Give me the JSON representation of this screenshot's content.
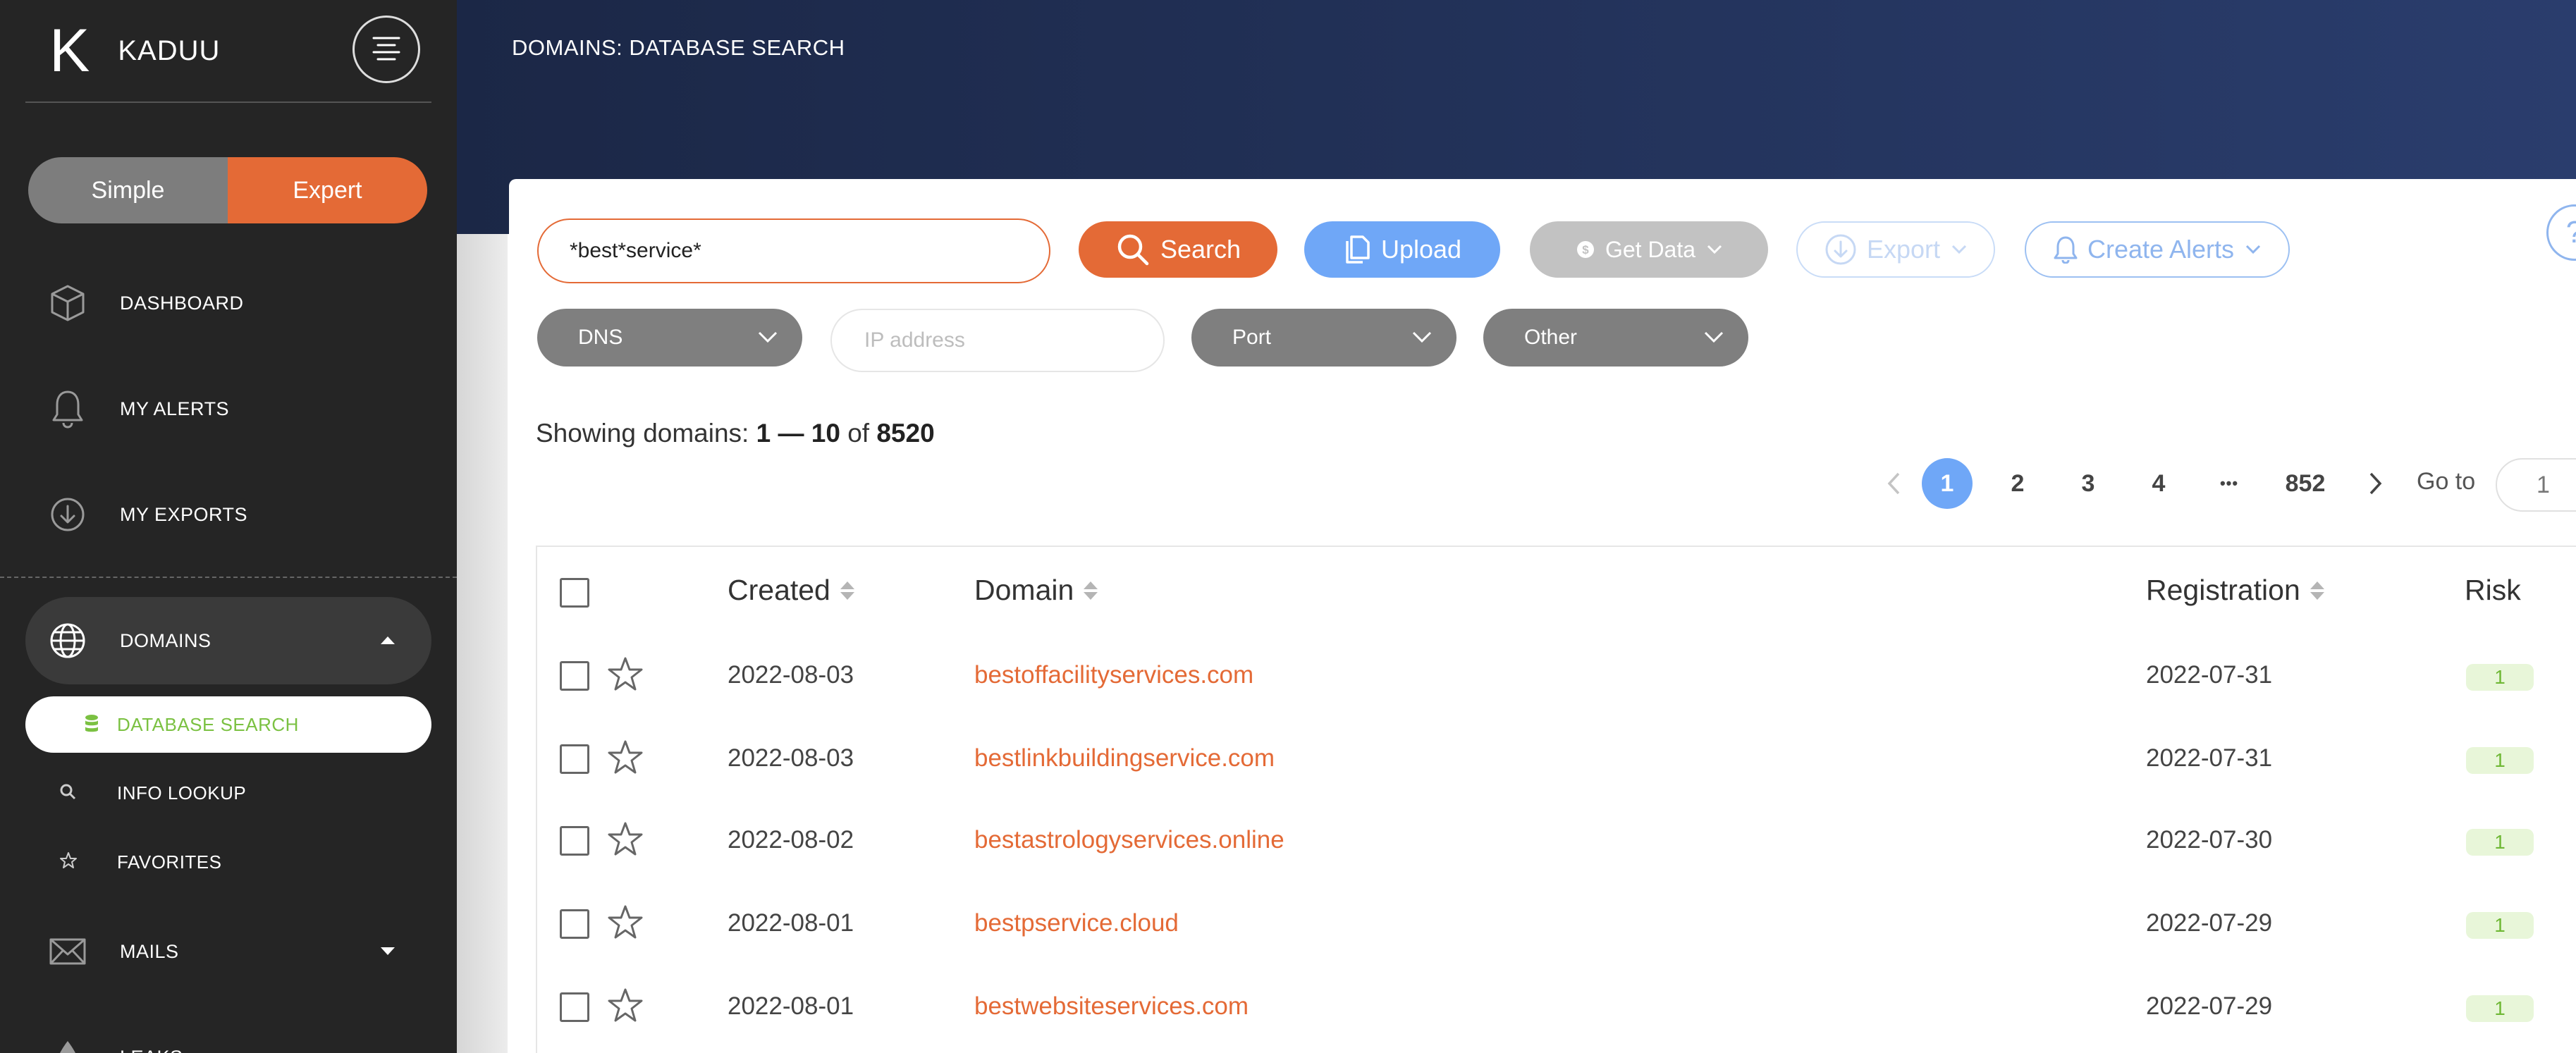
{
  "app": {
    "brand_letter": "K",
    "brand_name": "KADUU",
    "mode_simple": "Simple",
    "mode_expert": "Expert",
    "accent_color": "#e46a36",
    "blue_color": "#6fa7f7",
    "green_color": "#7bc142"
  },
  "sidebar": {
    "items": [
      {
        "label": "DASHBOARD",
        "icon": "cube-icon"
      },
      {
        "label": "MY ALERTS",
        "icon": "bell-icon"
      },
      {
        "label": "MY EXPORTS",
        "icon": "download-circle-icon"
      },
      {
        "label": "DOMAINS",
        "icon": "globe-icon"
      },
      {
        "label": "MAILS",
        "icon": "envelope-icon"
      },
      {
        "label": "LEAKS",
        "icon": "drop-icon"
      }
    ],
    "domains_sub": [
      {
        "label": "DATABASE SEARCH",
        "icon": "database-icon"
      },
      {
        "label": "INFO LOOKUP",
        "icon": "search-icon"
      },
      {
        "label": "FAVORITES",
        "icon": "star-icon"
      }
    ]
  },
  "header": {
    "title": "DOMAINS: DATABASE SEARCH"
  },
  "search": {
    "query": "*best*service*",
    "search_label": "Search",
    "upload_label": "Upload",
    "get_data_label": "Get Data",
    "export_label": "Export",
    "alerts_label": "Create Alerts",
    "help_label": "?"
  },
  "filters": {
    "dns_label": "DNS",
    "ip_placeholder": "IP address",
    "port_label": "Port",
    "other_label": "Other"
  },
  "results": {
    "showing_prefix": "Showing domains:",
    "range_start": "1",
    "range_sep": "—",
    "range_end": "10",
    "of_word": "of",
    "total": "8520"
  },
  "pagination": {
    "pages": [
      "1",
      "2",
      "3",
      "4"
    ],
    "ellipsis": "•••",
    "last": "852",
    "current": "1",
    "goto_label": "Go to",
    "goto_value": "1"
  },
  "table": {
    "columns": {
      "created": "Created",
      "domain": "Domain",
      "registration": "Registration",
      "risk": "Risk"
    },
    "rows": [
      {
        "created": "2022-08-03",
        "domain": "bestoffacilityservices.com",
        "registration": "2022-07-31",
        "risk": "1"
      },
      {
        "created": "2022-08-03",
        "domain": "bestlinkbuildingservice.com",
        "registration": "2022-07-31",
        "risk": "1"
      },
      {
        "created": "2022-08-02",
        "domain": "bestastrologyservices.online",
        "registration": "2022-07-30",
        "risk": "1"
      },
      {
        "created": "2022-08-01",
        "domain": "bestpservice.cloud",
        "registration": "2022-07-29",
        "risk": "1"
      },
      {
        "created": "2022-08-01",
        "domain": "bestwebsiteservices.com",
        "registration": "2022-07-29",
        "risk": "1"
      }
    ]
  }
}
